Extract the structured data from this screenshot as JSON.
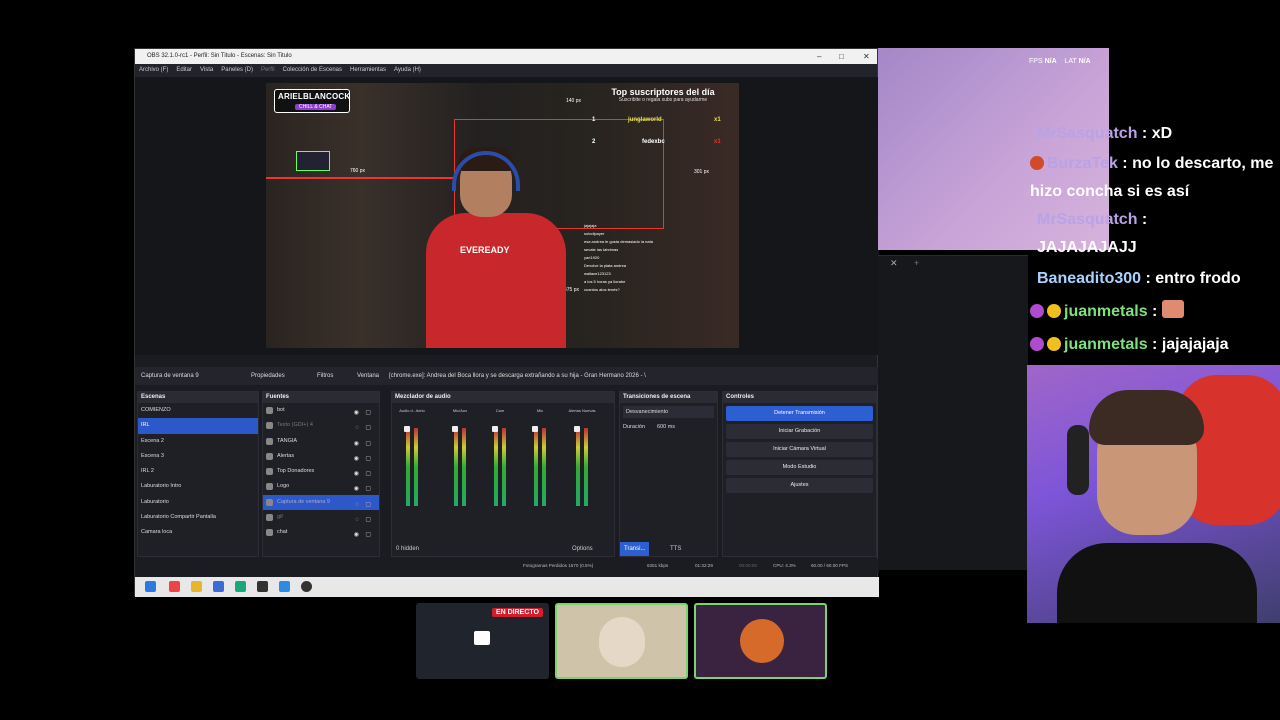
{
  "obs": {
    "title": "OBS 32.1.0-rc1 - Perfil: Sin Titulo - Escenas: Sin Titulo",
    "menu": [
      "Archivo (F)",
      "Editar",
      "Vista",
      "Paneles (D)",
      "Perfil",
      "Colección de Escenas",
      "Herramientas",
      "Ayuda (H)"
    ],
    "preview": {
      "logo_line1": "ARIELBLANCOCK",
      "logo_line2": "CHILL & CHAT",
      "top_title": "Top suscriptores del día",
      "top_sub": "Suscribite o regala subs para ayudarme",
      "ranks": [
        {
          "n": "1",
          "name": "junglaworld",
          "x": "x1"
        },
        {
          "n": "2",
          "name": "fedexbc",
          "x": "x1"
        }
      ],
      "measure_top": "140 px",
      "measure_left": "760 px",
      "measure_right": "301 px",
      "measure_bottom": "475 px",
      "shirt_text": "EVEREADY",
      "chat_lines": [
        "jajajaja",
        "solodipayer",
        "esa andrea le gusta demasiado la nata",
        "secate las lahrimas",
        "yari1920",
        "Devolve la plata andrea",
        "wallace123123",
        "a los 5 horas ya llorabe",
        "cuantos alos tenés?"
      ]
    },
    "source_tab": "Captura de ventana 9",
    "props_button": "Propiedades",
    "filters_button": "Filtros",
    "window_label": "Ventana",
    "window_value": "[chrome.exe]: Andrea del Boca llora y se descarga extrañando a su hija - Gran Hermano 2026 - \\",
    "scenes": {
      "title": "Escenas",
      "items": [
        "COMIENZO",
        "IRL",
        "Escena 2",
        "Escena 3",
        "IRL 2",
        "Laburatorio Intro",
        "Laburatorio",
        "Laburatorio Compartir Pantalla",
        "Camara loca"
      ]
    },
    "sources": {
      "title": "Fuentes",
      "items": [
        "bot",
        "Texto (GDI+) 4",
        "TANGIA",
        "Alertas",
        "Top Donadores",
        "Logo",
        "Captura de ventana 9",
        "gif",
        "chat"
      ]
    },
    "mixer": {
      "title": "Mezclador de audio",
      "channels": [
        "Audio d...itorio",
        "Mic/Aux",
        "Cam",
        "Mic",
        "Alertas Nuevas"
      ],
      "hidden": "0 hidden",
      "options": "Options"
    },
    "transitions": {
      "title": "Transiciones de escena",
      "type": "Desvanecimiento",
      "duration_label": "Duración",
      "duration_value": "600 ms"
    },
    "controls": {
      "title": "Controles",
      "buttons": [
        "Detener Transmisión",
        "Iniciar Grabación",
        "Iniciar Cámara Virtual",
        "Modo Estudio",
        "Ajustes"
      ]
    },
    "dock_bottom_tabs": [
      "Transi...",
      "TTS"
    ],
    "status": {
      "frames": "Fotogramas Perdidos 1570 (0.5%)",
      "kbps": "6351 kbps",
      "time_live": "01:32:29",
      "time_rec": "00:00:00",
      "cpu": "CPU: 4.3%",
      "fps": "60.00 / 60.00 FPS"
    }
  },
  "overlay": {
    "fps_label": "FPS",
    "fps_value": "N/A",
    "lat_label": "LAT",
    "lat_value": "N/A"
  },
  "chat": [
    {
      "user": "MrSasquatch",
      "msg": " : xD",
      "color": "#b9a2e6"
    },
    {
      "user": "BurzaTek",
      "msg": " : no lo descarto, me hizo concha si es así",
      "color": "#b9a2e6"
    },
    {
      "user": "MrSasquatch",
      "msg": " : JAJAJAJAJJ",
      "color": "#b9a2e6"
    },
    {
      "user": "Baneadito300",
      "msg": " : entro frodo",
      "color": "#a9d3ff"
    },
    {
      "user": "juanmetals",
      "msg": " : ",
      "color": "#7ee07e"
    },
    {
      "user": "juanmetals",
      "msg": " : jajajajaja",
      "color": "#7ee07e"
    }
  ],
  "tiles": {
    "live_label": "EN DIRECTO"
  }
}
